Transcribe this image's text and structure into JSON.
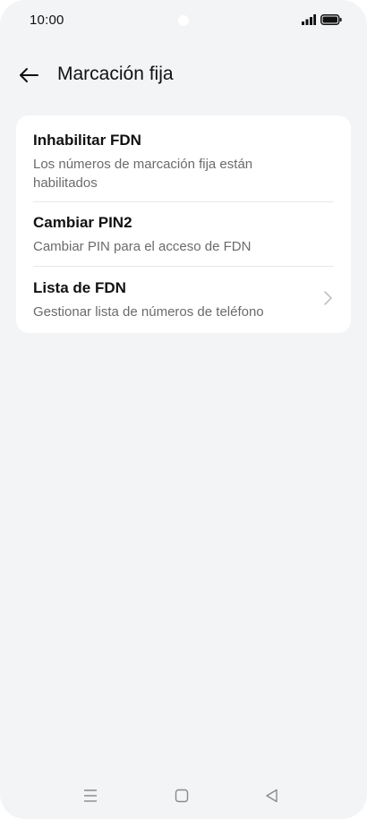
{
  "status_bar": {
    "time": "10:00"
  },
  "header": {
    "title": "Marcación fija",
    "back_icon": "arrow-left-icon"
  },
  "settings": {
    "items": [
      {
        "title": "Inhabilitar FDN",
        "subtitle": "Los números de marcación fija están habilitados"
      },
      {
        "title": "Cambiar PIN2",
        "subtitle": "Cambiar PIN para el acceso de FDN"
      },
      {
        "title": "Lista de FDN",
        "subtitle": "Gestionar lista de números de teléfono",
        "icon": "chevron-right-icon"
      }
    ]
  },
  "nav_bar": {
    "icons": [
      "menu-icon",
      "home-square-icon",
      "back-triangle-icon"
    ]
  },
  "colors": {
    "background": "#f3f4f6",
    "card": "#ffffff",
    "text_primary": "#111111",
    "text_secondary": "#6b6b6b",
    "divider": "#e8e8ea"
  }
}
